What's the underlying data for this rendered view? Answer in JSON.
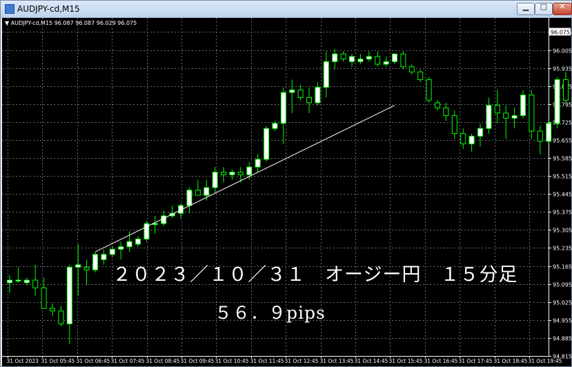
{
  "window": {
    "title": "AUDJPY-cd,M15",
    "buttons": {
      "minimize": "▁",
      "maximize": "□",
      "close": "✕"
    }
  },
  "chart_info": "AUDJPY-cd,M15  96.087 96.087 96.029 96.075",
  "annotations": {
    "headline": "２０２３／１０／３１　オージー円　１５分足",
    "pips": "５６．９pips"
  },
  "colors": {
    "background": "#000000",
    "grid": "#6f6f6f",
    "candle_up": "#ffffff",
    "candle_down": "#000000",
    "wick": "#00ff00",
    "text": "#ffffff"
  },
  "chart_data": {
    "type": "candlestick",
    "title": "AUDJPY-cd,M15",
    "ylim": [
      94.815,
      96.13
    ],
    "ytick_values": [
      94.815,
      94.885,
      94.955,
      95.025,
      95.095,
      95.165,
      95.235,
      95.305,
      95.375,
      95.445,
      95.515,
      95.585,
      95.655,
      95.725,
      95.795,
      95.865,
      95.935,
      96.005,
      96.075
    ],
    "ytick_labels": [
      "94.815",
      "94.885",
      "94.955",
      "95.025",
      "95.095",
      "95.165",
      "95.235",
      "95.305",
      "95.375",
      "95.445",
      "95.515",
      "95.585",
      "95.655",
      "95.725",
      "95.795",
      "95.865",
      "95.935",
      "96.005",
      "96.075"
    ],
    "xtick_labels": [
      "31 Oct 2023",
      "31 Oct 05:45",
      "31 Oct 06:45",
      "31 Oct 07:45",
      "31 Oct 08:45",
      "31 Oct 09:45",
      "31 Oct 10:45",
      "31 Oct 11:45",
      "31 Oct 12:45",
      "31 Oct 13:45",
      "31 Oct 14:45",
      "31 Oct 15:45",
      "31 Oct 16:45",
      "31 Oct 17:45",
      "31 Oct 18:45",
      "31 Oct 19:45"
    ],
    "current_price": 96.075,
    "trendline": {
      "start": {
        "bar": 10,
        "price": 95.22
      },
      "end": {
        "bar": 45,
        "price": 95.79
      }
    },
    "candles": [
      {
        "o": 95.1,
        "h": 95.13,
        "l": 95.06,
        "c": 95.11
      },
      {
        "o": 95.11,
        "h": 95.16,
        "l": 95.1,
        "c": 95.11
      },
      {
        "o": 95.1,
        "h": 95.12,
        "l": 95.09,
        "c": 95.11
      },
      {
        "o": 95.11,
        "h": 95.17,
        "l": 95.05,
        "c": 95.08
      },
      {
        "o": 95.08,
        "h": 95.12,
        "l": 95.0,
        "c": 95.0
      },
      {
        "o": 95.0,
        "h": 95.02,
        "l": 94.97,
        "c": 94.99
      },
      {
        "o": 94.99,
        "h": 95.01,
        "l": 94.93,
        "c": 94.94
      },
      {
        "o": 94.94,
        "h": 95.17,
        "l": 94.86,
        "c": 95.16
      },
      {
        "o": 95.16,
        "h": 95.25,
        "l": 95.05,
        "c": 95.17
      },
      {
        "o": 95.16,
        "h": 95.19,
        "l": 95.09,
        "c": 95.15
      },
      {
        "o": 95.15,
        "h": 95.22,
        "l": 95.14,
        "c": 95.21
      },
      {
        "o": 95.19,
        "h": 95.23,
        "l": 95.17,
        "c": 95.21
      },
      {
        "o": 95.21,
        "h": 95.24,
        "l": 95.2,
        "c": 95.23
      },
      {
        "o": 95.23,
        "h": 95.26,
        "l": 95.19,
        "c": 95.24
      },
      {
        "o": 95.24,
        "h": 95.3,
        "l": 95.22,
        "c": 95.26
      },
      {
        "o": 95.25,
        "h": 95.28,
        "l": 95.24,
        "c": 95.27
      },
      {
        "o": 95.27,
        "h": 95.34,
        "l": 95.26,
        "c": 95.33
      },
      {
        "o": 95.33,
        "h": 95.36,
        "l": 95.29,
        "c": 95.33
      },
      {
        "o": 95.33,
        "h": 95.38,
        "l": 95.32,
        "c": 95.36
      },
      {
        "o": 95.36,
        "h": 95.4,
        "l": 95.35,
        "c": 95.37
      },
      {
        "o": 95.37,
        "h": 95.41,
        "l": 95.35,
        "c": 95.4
      },
      {
        "o": 95.4,
        "h": 95.47,
        "l": 95.37,
        "c": 95.46
      },
      {
        "o": 95.46,
        "h": 95.5,
        "l": 95.45,
        "c": 95.44
      },
      {
        "o": 95.44,
        "h": 95.5,
        "l": 95.42,
        "c": 95.47
      },
      {
        "o": 95.47,
        "h": 95.55,
        "l": 95.45,
        "c": 95.53
      },
      {
        "o": 95.53,
        "h": 95.55,
        "l": 95.49,
        "c": 95.52
      },
      {
        "o": 95.52,
        "h": 95.54,
        "l": 95.5,
        "c": 95.53
      },
      {
        "o": 95.53,
        "h": 95.55,
        "l": 95.49,
        "c": 95.52
      },
      {
        "o": 95.52,
        "h": 95.57,
        "l": 95.5,
        "c": 95.55
      },
      {
        "o": 95.55,
        "h": 95.6,
        "l": 95.53,
        "c": 95.58
      },
      {
        "o": 95.58,
        "h": 95.71,
        "l": 95.57,
        "c": 95.7
      },
      {
        "o": 95.7,
        "h": 95.73,
        "l": 95.69,
        "c": 95.72
      },
      {
        "o": 95.72,
        "h": 95.86,
        "l": 95.64,
        "c": 95.84
      },
      {
        "o": 95.84,
        "h": 95.89,
        "l": 95.76,
        "c": 95.85
      },
      {
        "o": 95.85,
        "h": 95.87,
        "l": 95.81,
        "c": 95.82
      },
      {
        "o": 95.82,
        "h": 95.86,
        "l": 95.76,
        "c": 95.8
      },
      {
        "o": 95.8,
        "h": 95.88,
        "l": 95.79,
        "c": 95.86
      },
      {
        "o": 95.86,
        "h": 96.0,
        "l": 95.82,
        "c": 95.96
      },
      {
        "o": 95.96,
        "h": 96.01,
        "l": 95.93,
        "c": 95.99
      },
      {
        "o": 95.99,
        "h": 96.0,
        "l": 95.96,
        "c": 95.97
      },
      {
        "o": 95.96,
        "h": 95.99,
        "l": 95.94,
        "c": 95.98
      },
      {
        "o": 95.96,
        "h": 95.99,
        "l": 95.95,
        "c": 95.97
      },
      {
        "o": 95.97,
        "h": 96.0,
        "l": 95.96,
        "c": 95.98
      },
      {
        "o": 95.98,
        "h": 96.0,
        "l": 95.94,
        "c": 95.95
      },
      {
        "o": 95.95,
        "h": 95.98,
        "l": 95.94,
        "c": 95.96
      },
      {
        "o": 95.96,
        "h": 95.98,
        "l": 95.95,
        "c": 95.99
      },
      {
        "o": 95.99,
        "h": 96.0,
        "l": 95.93,
        "c": 95.94
      },
      {
        "o": 95.94,
        "h": 95.95,
        "l": 95.91,
        "c": 95.92
      },
      {
        "o": 95.92,
        "h": 95.93,
        "l": 95.88,
        "c": 95.89
      },
      {
        "o": 95.89,
        "h": 95.9,
        "l": 95.8,
        "c": 95.81
      },
      {
        "o": 95.8,
        "h": 95.81,
        "l": 95.77,
        "c": 95.78
      },
      {
        "o": 95.78,
        "h": 95.8,
        "l": 95.73,
        "c": 95.75
      },
      {
        "o": 95.75,
        "h": 95.77,
        "l": 95.66,
        "c": 95.68
      },
      {
        "o": 95.68,
        "h": 95.7,
        "l": 95.62,
        "c": 95.64
      },
      {
        "o": 95.64,
        "h": 95.68,
        "l": 95.61,
        "c": 95.67
      },
      {
        "o": 95.67,
        "h": 95.72,
        "l": 95.63,
        "c": 95.7
      },
      {
        "o": 95.7,
        "h": 95.82,
        "l": 95.68,
        "c": 95.79
      },
      {
        "o": 95.79,
        "h": 95.85,
        "l": 95.72,
        "c": 95.76
      },
      {
        "o": 95.76,
        "h": 95.79,
        "l": 95.66,
        "c": 95.74
      },
      {
        "o": 95.74,
        "h": 95.78,
        "l": 95.7,
        "c": 95.75
      },
      {
        "o": 95.75,
        "h": 95.85,
        "l": 95.74,
        "c": 95.83
      },
      {
        "o": 95.83,
        "h": 95.85,
        "l": 95.66,
        "c": 95.69
      },
      {
        "o": 95.69,
        "h": 95.71,
        "l": 95.6,
        "c": 95.65
      },
      {
        "o": 95.65,
        "h": 95.73,
        "l": 95.64,
        "c": 95.72
      },
      {
        "o": 95.72,
        "h": 95.9,
        "l": 95.7,
        "c": 95.89
      },
      {
        "o": 95.89,
        "h": 95.92,
        "l": 95.8,
        "c": 95.81
      },
      {
        "o": 95.81,
        "h": 95.91,
        "l": 95.79,
        "c": 95.9
      },
      {
        "o": 95.9,
        "h": 95.96,
        "l": 95.82,
        "c": 95.91
      },
      {
        "o": 95.91,
        "h": 96.02,
        "l": 95.89,
        "c": 95.99
      },
      {
        "o": 95.99,
        "h": 96.05,
        "l": 95.95,
        "c": 96.03
      },
      {
        "o": 96.03,
        "h": 96.05,
        "l": 95.75,
        "c": 95.88
      },
      {
        "o": 95.88,
        "h": 95.95,
        "l": 95.86,
        "c": 95.93
      }
    ]
  }
}
